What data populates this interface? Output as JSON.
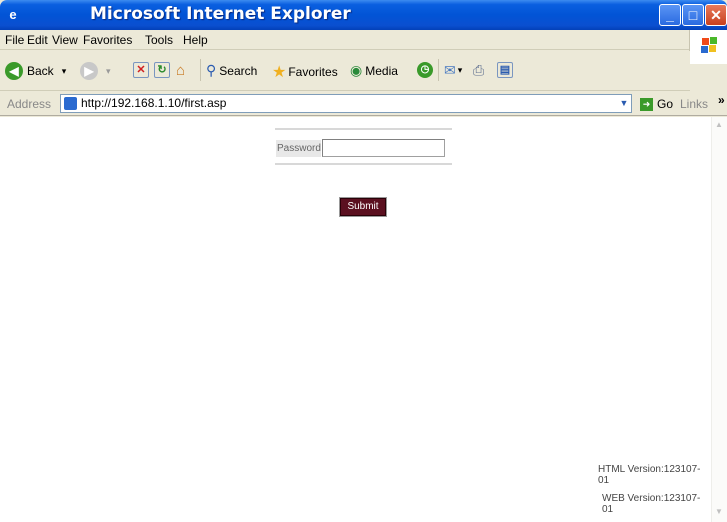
{
  "window": {
    "title": "Microsoft Internet Explorer",
    "app_icon": "e"
  },
  "menu": [
    "File",
    "Edit",
    "View",
    "Favorites",
    "Tools",
    "Help"
  ],
  "toolbar": {
    "back_label": "Back",
    "search_label": "Search",
    "favorites_label": "Favorites",
    "media_label": "Media"
  },
  "address": {
    "label": "Address",
    "url": "http://192.168.1.10/first.asp",
    "go_label": "Go",
    "links_label": "Links"
  },
  "page": {
    "password_label": "Password",
    "password_value": "",
    "submit_label": "Submit",
    "html_version": "HTML Version:123107-01",
    "web_version": "WEB Version:123107-01"
  },
  "colors": {
    "titlebar": "#0254d6",
    "submit_bg": "#5b1020"
  }
}
